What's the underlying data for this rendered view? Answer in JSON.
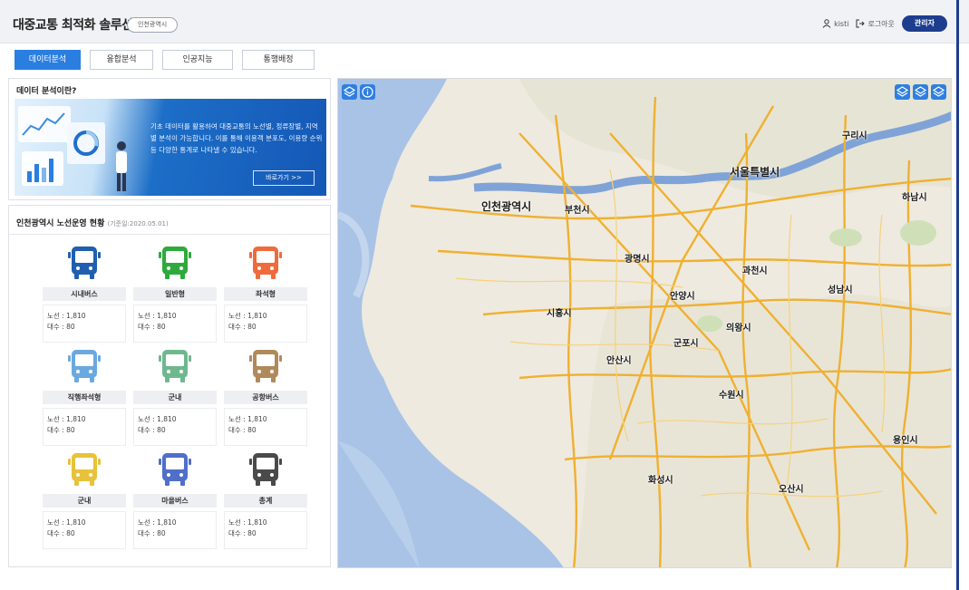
{
  "header": {
    "app_title": "대중교통 최적화 솔루션",
    "region": "인천광역시",
    "user_name": "kisti",
    "logout": "로그아웃",
    "admin": "관리자"
  },
  "tabs": [
    {
      "label": "데이터분석",
      "active": true
    },
    {
      "label": "융합분석",
      "active": false
    },
    {
      "label": "인공지능",
      "active": false
    },
    {
      "label": "통행배정",
      "active": false
    }
  ],
  "intro": {
    "title": "데이터 분석이란?",
    "text": "기초 데이터를 활용하여 대중교통의 노선별, 정류장별, 지역별 분석이 가능합니다. 이를 통해 이용객 분포도, 이용량 순위 등 다양한 통계로 나타낼 수 있습니다.",
    "button": "바로가기 >>"
  },
  "status": {
    "title": "인천광역시 노선운영 현황",
    "date": "(기준일:2020.05.01)",
    "cards": [
      {
        "label": "시내버스",
        "route": "노선 : 1,810",
        "count": "대수 : 80",
        "color": "#1f5fb0"
      },
      {
        "label": "일반형",
        "route": "노선 : 1,810",
        "count": "대수 : 80",
        "color": "#2eaa3c"
      },
      {
        "label": "좌석형",
        "route": "노선 : 1,810",
        "count": "대수 : 80",
        "color": "#ef6b3b"
      },
      {
        "label": "직행좌석형",
        "route": "노선 : 1,810",
        "count": "대수 : 80",
        "color": "#6aa9df"
      },
      {
        "label": "군내",
        "route": "노선 : 1,810",
        "count": "대수 : 80",
        "color": "#6fb88f"
      },
      {
        "label": "공항버스",
        "route": "노선 : 1,810",
        "count": "대수 : 80",
        "color": "#b08a5a"
      },
      {
        "label": "군내",
        "route": "노선 : 1,810",
        "count": "대수 : 80",
        "color": "#e7c23a"
      },
      {
        "label": "마을버스",
        "route": "노선 : 1,810",
        "count": "대수 : 80",
        "color": "#4f6fc8"
      },
      {
        "label": "총계",
        "route": "노선 : 1,810",
        "count": "대수 : 80",
        "color": "#4a4a4a"
      }
    ]
  },
  "map": {
    "cities": [
      "서울특별시",
      "인천광역시",
      "부천시",
      "광명시",
      "과천시",
      "안양시",
      "성남시",
      "시흥시",
      "의왕시",
      "군포시",
      "안산시",
      "수원시",
      "화성시",
      "오산시",
      "용인시",
      "구리시",
      "하남시"
    ]
  }
}
